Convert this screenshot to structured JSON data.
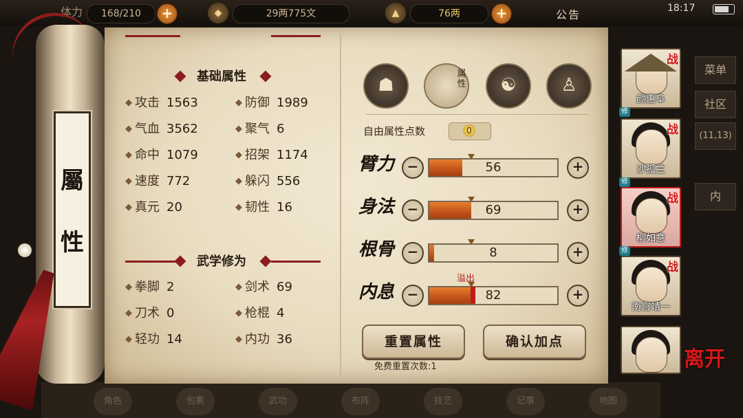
{
  "topbar": {
    "energy": "168/210",
    "energy_label": "体力",
    "silver": "29两775文",
    "gold": "76两",
    "plus": "+",
    "notice": "公告",
    "clock": "18:17"
  },
  "side_menu": {
    "menu": "菜单",
    "community": "社区",
    "coords": "(11,13)",
    "in": "内"
  },
  "bottom_nav": [
    "角色",
    "包裹",
    "武功",
    "布阵",
    "技艺",
    "记事",
    "地图"
  ],
  "scroll": {
    "char1": "屬",
    "char2": "性"
  },
  "basic": {
    "title": "基础属性",
    "stats": [
      {
        "label": "攻击",
        "value": "1563"
      },
      {
        "label": "防御",
        "value": "1989"
      },
      {
        "label": "气血",
        "value": "3562"
      },
      {
        "label": "聚气",
        "value": "6"
      },
      {
        "label": "命中",
        "value": "1079"
      },
      {
        "label": "招架",
        "value": "1174"
      },
      {
        "label": "速度",
        "value": "772"
      },
      {
        "label": "躲闪",
        "value": "556"
      },
      {
        "label": "真元",
        "value": "20"
      },
      {
        "label": "韧性",
        "value": "16"
      }
    ]
  },
  "martial": {
    "title": "武学修为",
    "stats": [
      {
        "label": "拳脚",
        "value": "2"
      },
      {
        "label": "剑术",
        "value": "69"
      },
      {
        "label": "刀术",
        "value": "0"
      },
      {
        "label": "枪棍",
        "value": "4"
      },
      {
        "label": "轻功",
        "value": "14"
      },
      {
        "label": "内功",
        "value": "36"
      }
    ]
  },
  "tabs": {
    "attr_label": "属性"
  },
  "free_points": {
    "label": "自由属性点数",
    "value": "0"
  },
  "attributes": [
    {
      "name": "臂力",
      "value": "56",
      "fill": 0.26,
      "mark": 0.33
    },
    {
      "name": "身法",
      "value": "69",
      "fill": 0.33,
      "mark": 0.33
    },
    {
      "name": "根骨",
      "value": "8",
      "fill": 0.04,
      "mark": 0.33
    },
    {
      "name": "内息",
      "value": "82",
      "fill": 0.36,
      "mark": 0.33
    }
  ],
  "overflow_label": "溢出",
  "buttons": {
    "reset": "重置属性",
    "confirm": "确认加点",
    "reset_count": "免费重置次数:1",
    "minus": "−",
    "plus": "+"
  },
  "heroes": [
    {
      "name": "颜惠阜",
      "tag": "战"
    },
    {
      "name": "沙孤兰",
      "tag": "战"
    },
    {
      "name": "柳如意",
      "tag": "战"
    },
    {
      "name": "南宫靖一",
      "tag": "战"
    },
    {
      "name": "",
      "tag": ""
    }
  ],
  "hero_badge": "修",
  "leave": "离开",
  "colors": {
    "accent": "#8b1d1d",
    "bar": "#c2531a",
    "overflow": "#c01a1a",
    "paper": "#efe4cc"
  }
}
